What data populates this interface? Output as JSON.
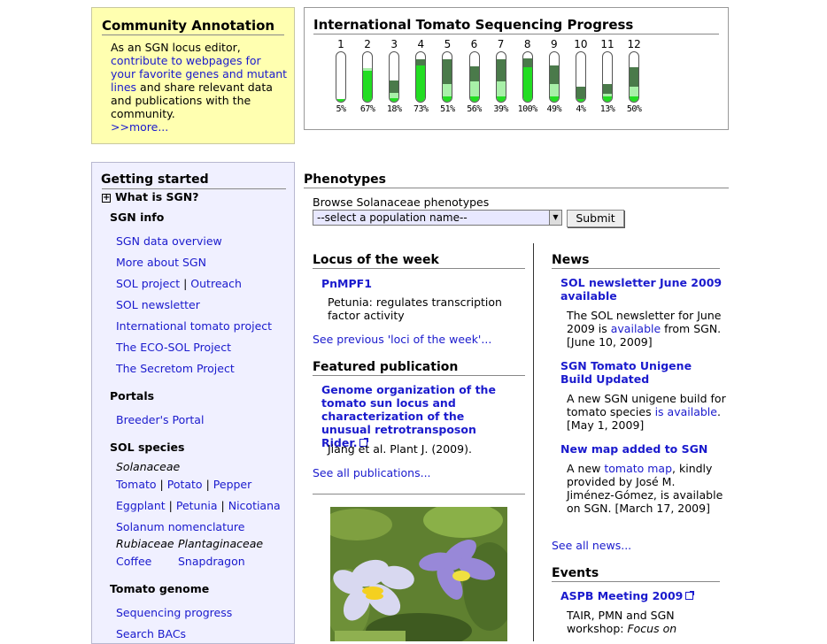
{
  "community": {
    "title": "Community Annotation",
    "text1": "As an SGN locus editor, ",
    "link1": "contribute to webpages for your favorite genes and mutant lines",
    "text2": " and share relevant data and publications with the community.",
    "more": ">>more..."
  },
  "progress": {
    "title": "International Tomato Sequencing Progress",
    "colors": {
      "finished": "#22dd22",
      "in_progress": "#a8f0a8",
      "planned": "#4a7a4a"
    },
    "chromosomes": [
      {
        "num": "1",
        "pct": "5%",
        "finished": 0.05,
        "in_progress": 0.0,
        "planned": 0.0
      },
      {
        "num": "2",
        "pct": "67%",
        "finished": 0.62,
        "in_progress": 0.05,
        "planned": 0.0
      },
      {
        "num": "3",
        "pct": "18%",
        "finished": 0.08,
        "in_progress": 0.1,
        "planned": 0.25
      },
      {
        "num": "4",
        "pct": "73%",
        "finished": 0.73,
        "in_progress": 0.0,
        "planned": 0.12
      },
      {
        "num": "5",
        "pct": "51%",
        "finished": 0.1,
        "in_progress": 0.25,
        "planned": 0.5
      },
      {
        "num": "6",
        "pct": "56%",
        "finished": 0.1,
        "in_progress": 0.3,
        "planned": 0.3
      },
      {
        "num": "7",
        "pct": "39%",
        "finished": 0.1,
        "in_progress": 0.3,
        "planned": 0.45
      },
      {
        "num": "8",
        "pct": "100%",
        "finished": 0.7,
        "in_progress": 0.0,
        "planned": 0.18
      },
      {
        "num": "9",
        "pct": "49%",
        "finished": 0.1,
        "in_progress": 0.25,
        "planned": 0.38
      },
      {
        "num": "10",
        "pct": "4%",
        "finished": 0.05,
        "in_progress": 0.0,
        "planned": 0.25
      },
      {
        "num": "11",
        "pct": "13%",
        "finished": 0.1,
        "in_progress": 0.05,
        "planned": 0.2
      },
      {
        "num": "12",
        "pct": "50%",
        "finished": 0.1,
        "in_progress": 0.2,
        "planned": 0.4
      }
    ]
  },
  "sidebar": {
    "getting_started": "Getting started",
    "what_is": "What is SGN?",
    "sgn_info": "SGN info",
    "info_links": [
      "SGN data overview",
      "More about SGN",
      "SOL project",
      "Outreach",
      "SOL newsletter",
      "International tomato project",
      "The ECO-SOL Project",
      "The Secretom Project"
    ],
    "portals": "Portals",
    "breeders": "Breeder's Portal",
    "sol_species": "SOL species",
    "solanaceae": "Solanaceae",
    "species": [
      "Tomato",
      "Potato",
      "Pepper",
      "Eggplant",
      "Petunia",
      "Nicotiana"
    ],
    "nomenclature": "Solanum nomenclature",
    "rubiaceae": "Rubiaceae",
    "plantaginaceae": "Plantaginaceae",
    "coffee": "Coffee",
    "snapdragon": "Snapdragon",
    "tomato_genome": "Tomato genome",
    "seq_progress": "Sequencing progress",
    "search_bacs": "Search BACs"
  },
  "phenotypes": {
    "title": "Phenotypes",
    "label": "Browse Solanaceae phenotypes",
    "select_value": "--select a population name--",
    "submit": "Submit"
  },
  "locus": {
    "title": "Locus of the week",
    "name": "PnMPF1",
    "desc": "Petunia: regulates transcription factor activity",
    "previous": "See previous 'loci of the week'..."
  },
  "publication": {
    "title": "Featured publication",
    "paper": "Genome organization of the tomato sun locus and characterization of the unusual retrotransposon Rider.",
    "authors": "Jiang et al. Plant J. (2009).",
    "all": "See all publications..."
  },
  "news": {
    "title": "News",
    "item1_title": "SOL newsletter June 2009 available",
    "item1_text_a": "The SOL newsletter for June 2009 is ",
    "item1_link": "available",
    "item1_text_b": " from SGN. [June 10, 2009]",
    "item2_title": "SGN Tomato Unigene Build Updated",
    "item2_text_a": "A new SGN unigene build for tomato species ",
    "item2_link": "is available",
    "item2_text_b": ". [May 1, 2009]",
    "item3_title": "New map added to SGN",
    "item3_text_a": "A new ",
    "item3_link": "tomato map",
    "item3_text_b": ", kindly provided by José M. Jiménez-Gómez, is available on SGN. [March 17, 2009]",
    "all": "See all news..."
  },
  "events": {
    "title": "Events",
    "item1_title": "ASPB Meeting 2009",
    "item1_text_a": "TAIR, PMN and SGN workshop: ",
    "item1_text_b": "Focus on"
  }
}
